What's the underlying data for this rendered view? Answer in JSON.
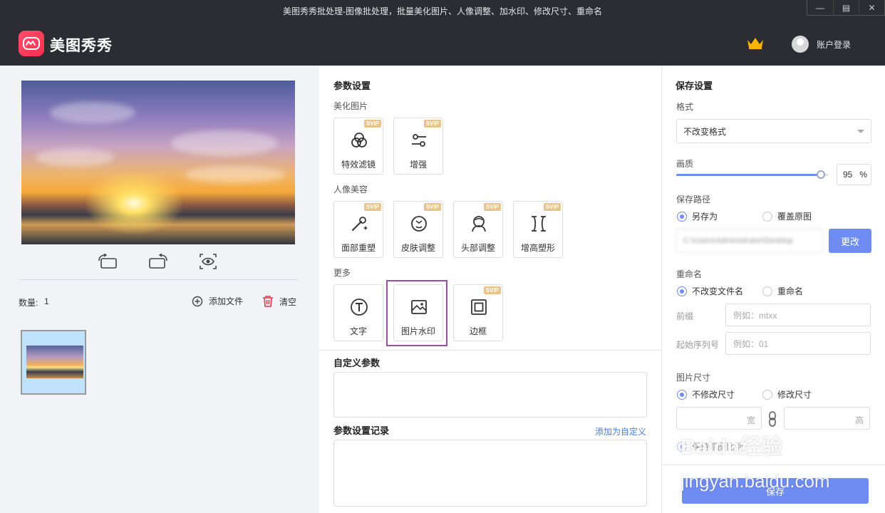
{
  "window": {
    "title": "美图秀秀批处理-图像批处理，批量美化图片、人像调整、加水印、修改尺寸、重命名",
    "controls": [
      "minimize",
      "maximize",
      "close"
    ]
  },
  "header": {
    "brand": "美图秀秀",
    "login": "账户登录",
    "accent": "#ff3b5c"
  },
  "left": {
    "count_label": "数量:",
    "count_value": "1",
    "add_file": "添加文件",
    "clear": "清空"
  },
  "params": {
    "title": "参数设置",
    "groups": [
      {
        "label": "美化图片",
        "tools": [
          {
            "label": "特效滤镜",
            "badge": "SVIP",
            "icon": "filter-icon"
          },
          {
            "label": "增强",
            "badge": "SVIP",
            "icon": "sliders-icon"
          }
        ]
      },
      {
        "label": "人像美容",
        "tools": [
          {
            "label": "面部重塑",
            "badge": "SVIP",
            "icon": "magic-wand-icon"
          },
          {
            "label": "皮肤调整",
            "badge": "SVIP",
            "icon": "face-icon"
          },
          {
            "label": "头部调整",
            "badge": "SVIP",
            "icon": "head-icon"
          },
          {
            "label": "增高塑形",
            "badge": "SVIP",
            "icon": "body-shape-icon"
          }
        ]
      },
      {
        "label": "更多",
        "tools": [
          {
            "label": "文字",
            "badge": "",
            "icon": "text-icon"
          },
          {
            "label": "图片水印",
            "badge": "",
            "icon": "image-watermark-icon"
          },
          {
            "label": "边框",
            "badge": "SVIP",
            "icon": "frame-icon"
          }
        ]
      }
    ],
    "custom_title": "自定义参数",
    "record_title": "参数设置记录",
    "add_custom_link": "添加为自定义"
  },
  "save": {
    "title": "保存设置",
    "format_label": "格式",
    "format_value": "不改变格式",
    "quality_label": "画质",
    "quality_value": "95",
    "quality_unit": "%",
    "quality_fraction": 0.95,
    "path_label": "保存路径",
    "path_options": [
      "另存为",
      "覆盖原图"
    ],
    "path_value": "C:\\Users\\Administrator\\Desktop",
    "change_button": "更改",
    "rename_label": "重命名",
    "rename_options": [
      "不改变文件名",
      "重命名"
    ],
    "prefix_label": "前缀",
    "prefix_placeholder": "例如：mtxx",
    "start_label": "起始序列号",
    "start_placeholder": "例如：01",
    "size_label": "图片尺寸",
    "size_options": [
      "不修改尺寸",
      "修改尺寸"
    ],
    "width_suffix": "宽",
    "height_suffix": "高",
    "keep_ratio": "保持原图比例",
    "save_button": "保存"
  },
  "watermark": {
    "line1": "Baidu经验",
    "line2": "jingyan.baidu.com"
  }
}
